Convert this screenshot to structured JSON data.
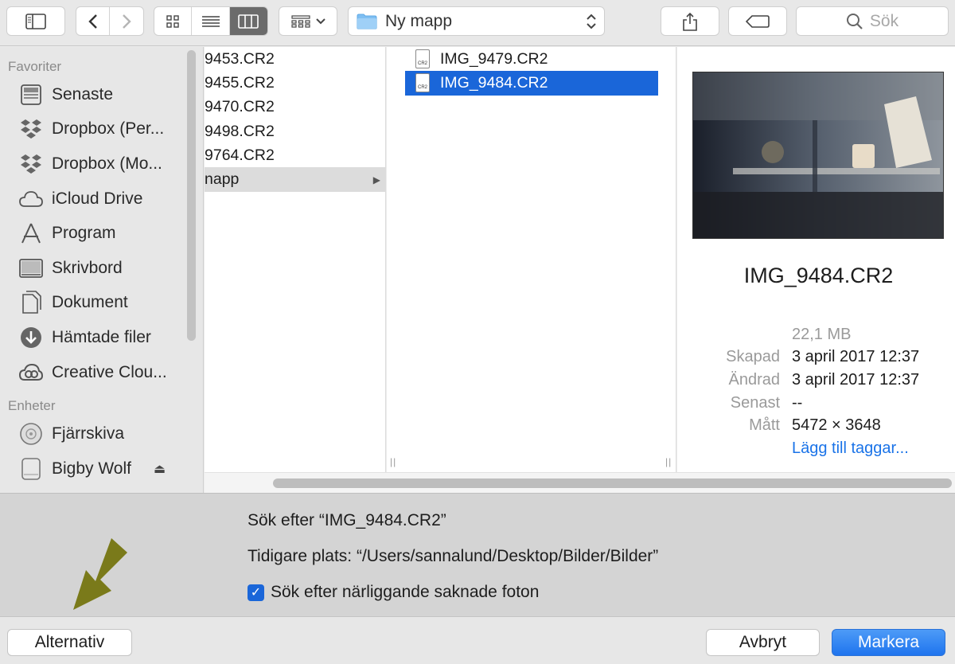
{
  "toolbar": {
    "path_label": "Ny mapp",
    "search_placeholder": "Sök"
  },
  "sidebar": {
    "favorites_header": "Favoriter",
    "favorites": [
      {
        "label": "Senaste",
        "icon": "recents-icon"
      },
      {
        "label": "Dropbox (Per...",
        "icon": "dropbox-icon"
      },
      {
        "label": "Dropbox (Mo...",
        "icon": "dropbox-icon"
      },
      {
        "label": "iCloud Drive",
        "icon": "cloud-icon"
      },
      {
        "label": "Program",
        "icon": "applications-icon"
      },
      {
        "label": "Skrivbord",
        "icon": "desktop-icon"
      },
      {
        "label": "Dokument",
        "icon": "document-icon"
      },
      {
        "label": "Hämtade filer",
        "icon": "download-icon"
      },
      {
        "label": "Creative Clou...",
        "icon": "creative-cloud-icon"
      }
    ],
    "devices_header": "Enheter",
    "devices": [
      {
        "label": "Fjärrskiva",
        "icon": "disc-icon"
      },
      {
        "label": "Bigby Wolf",
        "icon": "drive-icon"
      }
    ]
  },
  "column1": {
    "items": [
      "9453.CR2",
      "9455.CR2",
      "9470.CR2",
      "9498.CR2",
      "9764.CR2",
      "napp"
    ]
  },
  "column2": {
    "items": [
      "IMG_9479.CR2",
      "IMG_9484.CR2"
    ],
    "file_badge": "CR2"
  },
  "preview": {
    "name": "IMG_9484.CR2",
    "size": "22,1 MB",
    "info": [
      {
        "key": "Skapad",
        "value": "3 april 2017 12:37"
      },
      {
        "key": "Ändrad",
        "value": "3 april 2017 12:37"
      },
      {
        "key": "Senast",
        "value": "--"
      },
      {
        "key": "Mått",
        "value": "5472 × 3648"
      }
    ],
    "add_tags": "Lägg till taggar..."
  },
  "dialog": {
    "search_for": "Sök efter “IMG_9484.CR2”",
    "previous_location": "Tidigare plats: “/Users/sannalund/Desktop/Bilder/Bilder”",
    "checkbox_label": "Sök efter närliggande saknade foton"
  },
  "footer": {
    "options_label": "Alternativ",
    "cancel_label": "Avbryt",
    "select_label": "Markera"
  },
  "colors": {
    "selection_blue": "#1a66d9",
    "annotation_arrow": "#7a7a1a",
    "link": "#1a73e8"
  }
}
